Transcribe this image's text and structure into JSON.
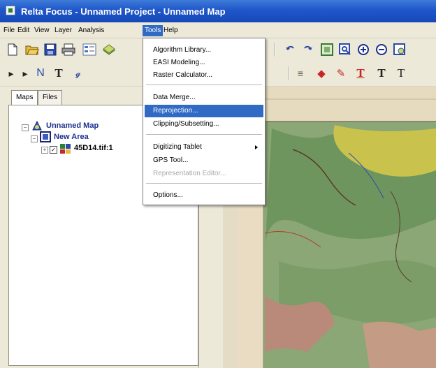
{
  "window": {
    "title": "Relta Focus - Unnamed Project - Unnamed Map"
  },
  "menubar": [
    "File",
    "Edit",
    "View",
    "Layer",
    "Analysis",
    "Tools",
    "Help"
  ],
  "tools_menu": {
    "items": [
      {
        "label": "Algorithm Library...",
        "state": "normal"
      },
      {
        "label": "EASI Modeling...",
        "state": "normal"
      },
      {
        "label": "Raster Calculator...",
        "state": "normal"
      },
      {
        "label": "Data Merge...",
        "state": "normal"
      },
      {
        "label": "Reprojection...",
        "state": "highlighted"
      },
      {
        "label": "Clipping/Subsetting...",
        "state": "normal"
      },
      {
        "label": "Digitizing Tablet",
        "state": "submenu"
      },
      {
        "label": "GPS Tool...",
        "state": "normal"
      },
      {
        "label": "Representation Editor...",
        "state": "disabled"
      },
      {
        "label": "Options...",
        "state": "normal"
      }
    ]
  },
  "panel": {
    "tabs": [
      "Maps",
      "Files"
    ],
    "tree": {
      "map": "Unnamed Map",
      "area": "New Area",
      "layer": "45D14.tif:1"
    }
  },
  "toolbar_icons": [
    "new-icon",
    "open-icon",
    "save-icon",
    "print-icon",
    "select-icon",
    "undo-icon",
    "redo-icon",
    "zoom-extent-icon",
    "zoom-box-icon",
    "zoom-in-icon",
    "zoom-out-icon"
  ],
  "colors": {
    "titlebar": "#1f56c9",
    "highlight": "#316ac5",
    "tree_text": "#1b2f8f"
  }
}
